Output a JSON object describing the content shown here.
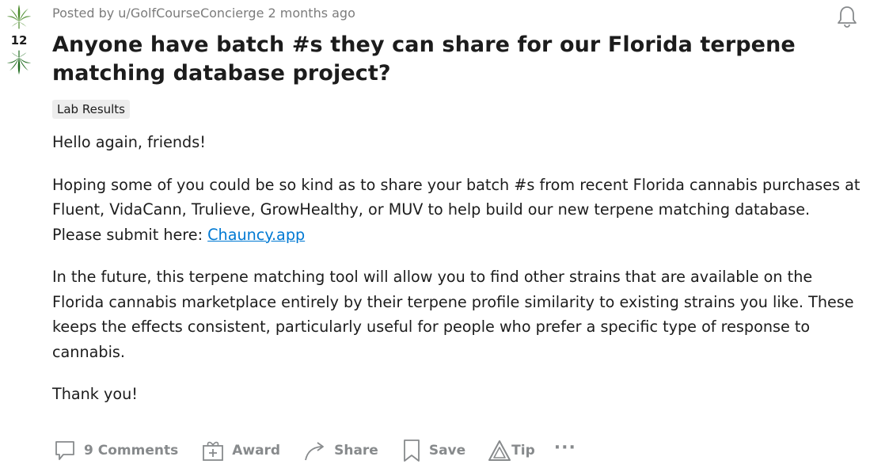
{
  "post": {
    "score": "12",
    "meta": {
      "prefix": "Posted by ",
      "author": "u/GolfCourseConcierge",
      "age": " 2 months ago"
    },
    "title": "Anyone have batch #s they can share for our Florida terpene matching database project?",
    "flair": "Lab Results",
    "body": {
      "p1": "Hello again, friends!",
      "p2_text": "Hoping some of you could be so kind as to share your batch #s from recent Florida cannabis purchases at Fluent, VidaCann, Trulieve, GrowHealthy, or MUV to help build our new terpene matching database. Please submit here: ",
      "p2_link": "Chauncy.app",
      "p3": "In the future, this terpene matching tool will allow you to find other strains that are available on the Florida cannabis marketplace entirely by their terpene profile similarity to existing strains you like. These keeps the effects consistent, particularly useful for people who prefer a specific type of response to cannabis.",
      "p4": "Thank you!"
    }
  },
  "actions": {
    "comments": "9 Comments",
    "award": "Award",
    "share": "Share",
    "save": "Save",
    "tip": "Tip",
    "more": "···"
  },
  "icons": {
    "upvote": "cannabis-leaf-icon",
    "downvote": "cannabis-leaf-icon",
    "notify": "bell-icon",
    "comments": "comment-bubble-icon",
    "award": "gift-box-icon",
    "share": "share-arrow-icon",
    "save": "bookmark-icon",
    "tip": "triangle-tip-icon"
  },
  "colors": {
    "leaf_up": "#4a8a2a",
    "leaf_down": "#1e6b1e",
    "link": "#0079d3",
    "action_gray": "#878a8c",
    "meta_gray": "#7c7c7c",
    "flair_bg": "#ededed"
  }
}
